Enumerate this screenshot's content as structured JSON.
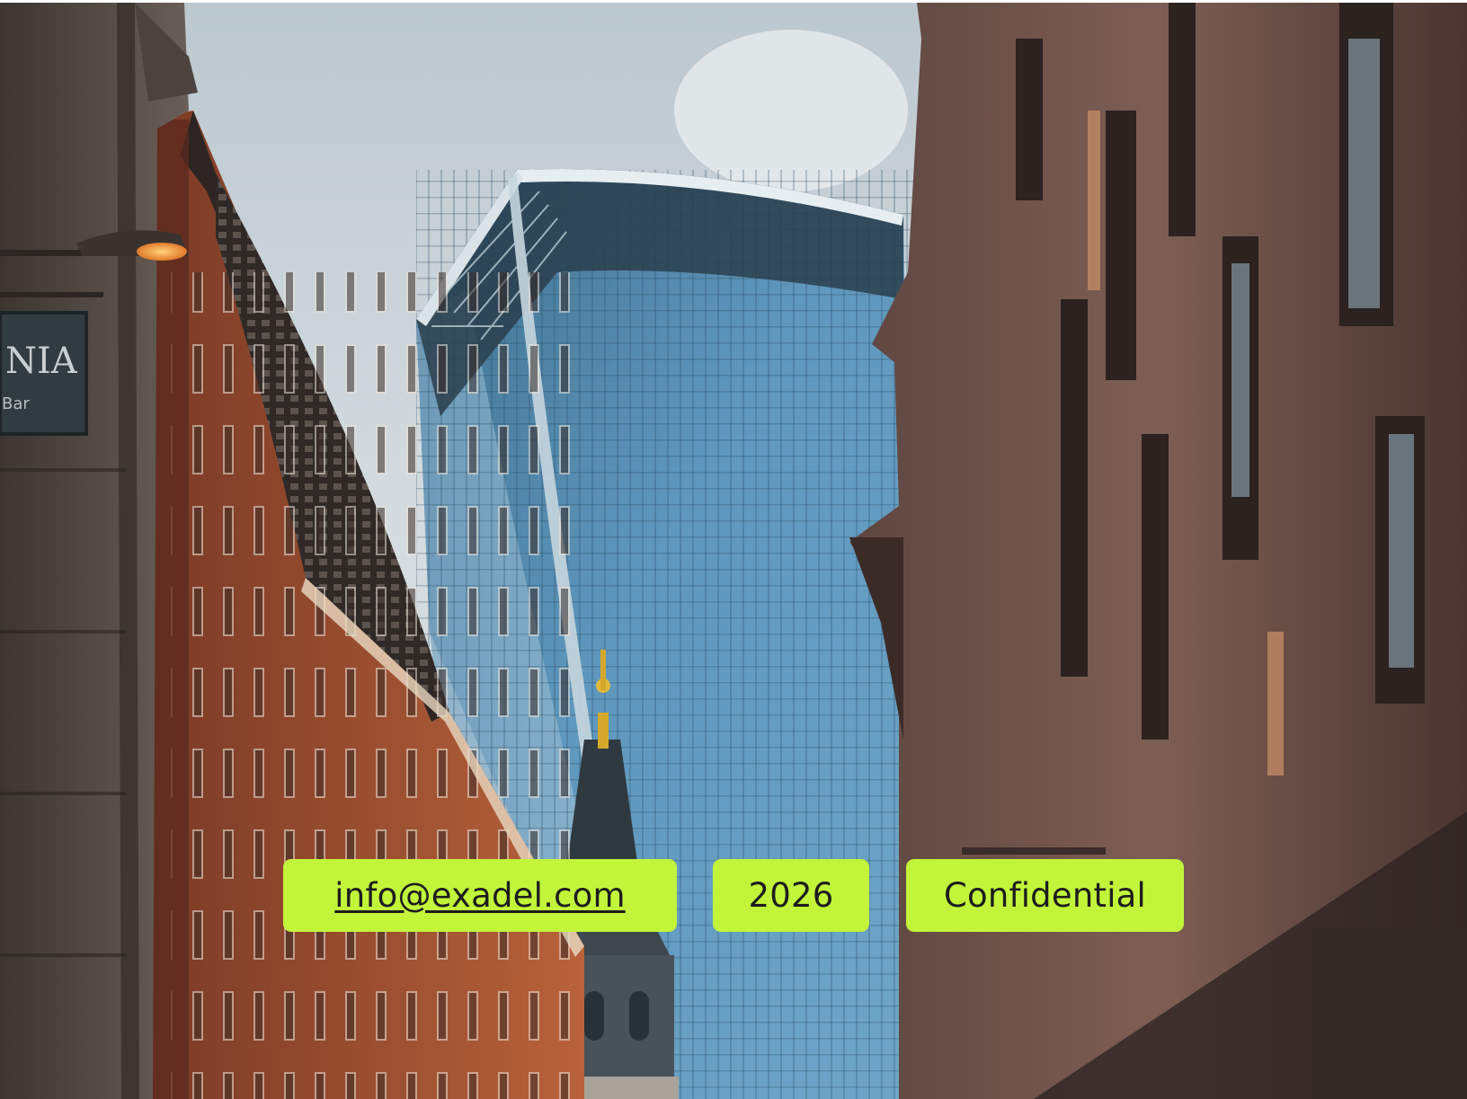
{
  "background_photo": {
    "sign": {
      "title": "NIA",
      "subtitle": "Bar"
    }
  },
  "footer": {
    "email": "info@exadel.com",
    "year": "2026",
    "label": "Confidential"
  },
  "colors": {
    "pill_background": "#c2f53a",
    "pill_text": "#1d1d1d"
  },
  "icons": [
    "street-lamp-icon"
  ]
}
